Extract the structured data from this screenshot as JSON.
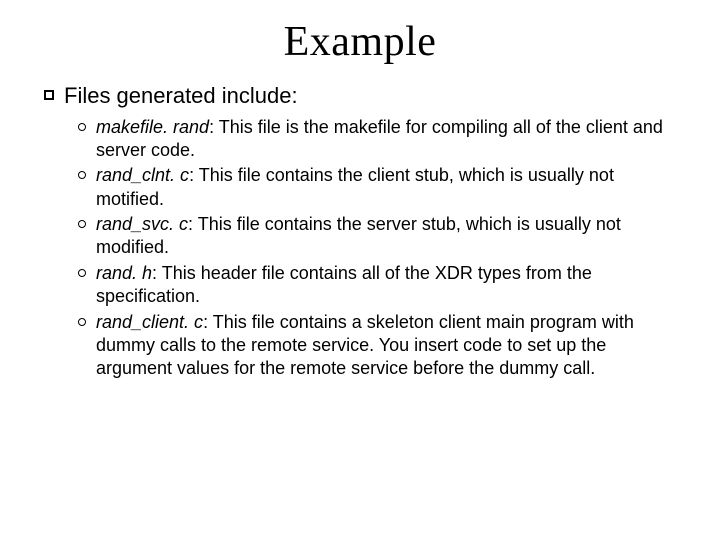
{
  "title": "Example",
  "main": {
    "heading": "Files generated include:",
    "items": [
      {
        "term": "makefile. rand",
        "desc": ": This file is the makefile for compiling all of the client and server code."
      },
      {
        "term": "rand_clnt. c",
        "desc": ": This file contains the client stub, which is usually not motified."
      },
      {
        "term": "rand_svc. c",
        "desc": ": This file contains the server stub, which is usually not modified."
      },
      {
        "term": "rand. h",
        "desc": ": This header file contains all of the XDR types from the specification."
      },
      {
        "term": "rand_client. c",
        "desc": ": This file contains a skeleton client main program with dummy calls to the remote service.  You insert code to set up the argument values for the remote service before the dummy call."
      }
    ]
  }
}
